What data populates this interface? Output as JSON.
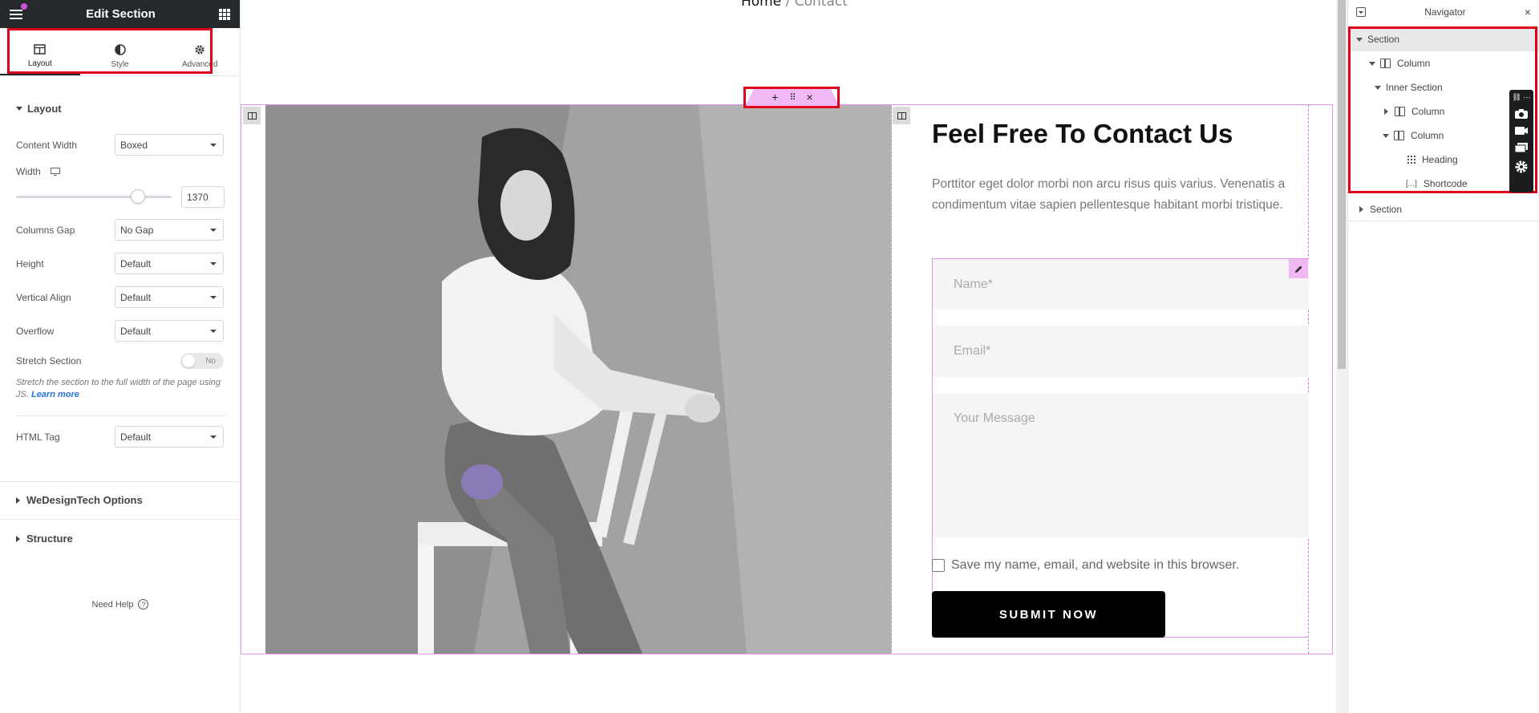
{
  "panel": {
    "title": "Edit Section",
    "tabs": [
      {
        "label": "Layout",
        "icon": "layout-icon"
      },
      {
        "label": "Style",
        "icon": "style-icon"
      },
      {
        "label": "Advanced",
        "icon": "gear-icon"
      }
    ],
    "layout_section": {
      "title": "Layout",
      "content_width": {
        "label": "Content Width",
        "value": "Boxed"
      },
      "width": {
        "label": "Width",
        "value": "1370",
        "slider_fraction": 0.73
      },
      "columns_gap": {
        "label": "Columns Gap",
        "value": "No Gap"
      },
      "height": {
        "label": "Height",
        "value": "Default"
      },
      "vertical_align": {
        "label": "Vertical Align",
        "value": "Default"
      },
      "overflow": {
        "label": "Overflow",
        "value": "Default"
      },
      "stretch_section": {
        "label": "Stretch Section",
        "toggle": "No"
      },
      "stretch_desc": "Stretch the section to the full width of the page using JS.",
      "learn_more": "Learn more",
      "html_tag": {
        "label": "HTML Tag",
        "value": "Default"
      }
    },
    "wedesign_section": "WeDesignTech Options",
    "structure_section": "Structure",
    "need_help": "Need Help"
  },
  "canvas": {
    "breadcrumb_home": "Home",
    "breadcrumb_sep": "/",
    "breadcrumb_current": "Contact",
    "heading": "Feel Free To Contact Us",
    "paragraph": "Porttitor eget dolor morbi non arcu risus quis varius. Venenatis a condimentum vitae sapien pellentesque habitant morbi tristique.",
    "form": {
      "name_placeholder": "Name*",
      "email_placeholder": "Email*",
      "message_placeholder": "Your Message",
      "checkbox_label": "Save my name, email, and website in this browser.",
      "submit_label": "SUBMIT NOW"
    }
  },
  "navigator": {
    "title": "Navigator",
    "items": [
      {
        "label": "Section",
        "icon": "caret-down"
      },
      {
        "label": "Column",
        "icon": "column-icon"
      },
      {
        "label": "Inner Section",
        "icon": "caret-down"
      },
      {
        "label": "Column",
        "icon": "column-icon"
      },
      {
        "label": "Column",
        "icon": "column-icon"
      },
      {
        "label": "Heading",
        "icon": "heading-grid-icon"
      },
      {
        "label": "Shortcode",
        "icon": "shortcode-icon"
      },
      {
        "label": "Section",
        "icon": "caret-right"
      }
    ]
  },
  "colors": {
    "accent_pink": "#e196e8",
    "highlight_red": "#e0001b",
    "header_dark": "#26292c"
  }
}
